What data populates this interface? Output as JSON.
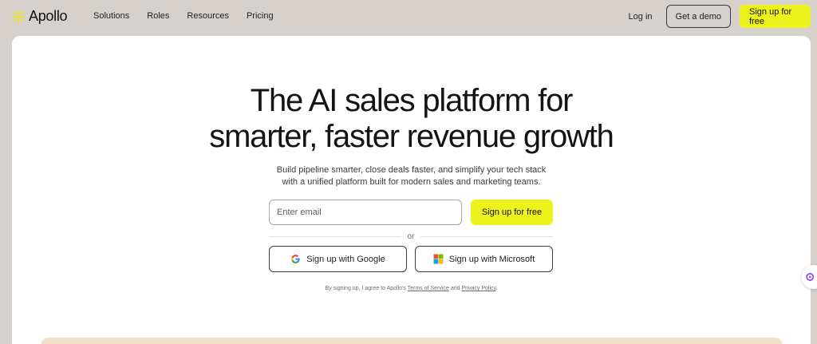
{
  "brand": {
    "name": "Apollo",
    "accent": "#ebf21c",
    "logo_color": "#ebe34a"
  },
  "nav": {
    "links": [
      "Solutions",
      "Roles",
      "Resources",
      "Pricing"
    ],
    "login": "Log in",
    "demo": "Get a demo",
    "signup": "Sign up for free"
  },
  "hero": {
    "title_line1": "The AI sales platform for",
    "title_line2": "smarter, faster revenue growth",
    "subtitle_line1": "Build pipeline smarter, close deals faster, and simplify your tech stack",
    "subtitle_line2": "with a unified platform built for modern sales and marketing teams."
  },
  "form": {
    "email_placeholder": "Enter email",
    "email_value": "",
    "signup_button": "Sign up for free",
    "divider": "or",
    "google_button": "Sign up with Google",
    "microsoft_button": "Sign up with Microsoft"
  },
  "legal": {
    "prefix": "By signing up, I agree to Apollo's",
    "terms": "Terms of Service",
    "and": "and",
    "privacy": "Privacy Policy",
    "suffix": "."
  },
  "icons": {
    "logo": "apollo-sun-icon",
    "google": "google-icon",
    "microsoft": "microsoft-icon",
    "widget": "brain-icon"
  }
}
